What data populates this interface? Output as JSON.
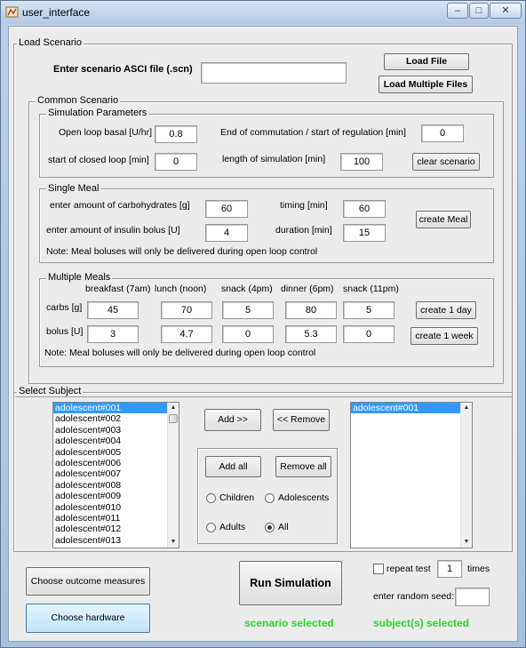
{
  "window": {
    "title": "user_interface",
    "controls": {
      "minimize": "–",
      "maximize": "□",
      "close": "✕"
    }
  },
  "load_scenario": {
    "legend": "Load Scenario",
    "file_label": "Enter scenario ASCI file (.scn)",
    "file_value": "",
    "load_file_button": "Load File",
    "load_multiple_button": "Load Multiple Files"
  },
  "common_scenario": {
    "legend": "Common Scenario",
    "simulation_parameters": {
      "legend": "Simulation Parameters",
      "open_loop_basal_label": "Open loop basal [U/hr]",
      "open_loop_basal_value": "0.8",
      "end_commutation_label": "End of commutation / start of regulation [min]",
      "end_commutation_value": "0",
      "start_closed_loop_label": "start of closed loop [min]",
      "start_closed_loop_value": "0",
      "length_label": "length of simulation [min]",
      "length_value": "100",
      "clear_button": "clear scenario"
    },
    "single_meal": {
      "legend": "Single Meal",
      "carbs_label": "enter amount of carbohydrates [g]",
      "carbs_value": "60",
      "timing_label": "timing [min]",
      "timing_value": "60",
      "insulin_label": "enter amount of insulin bolus [U]",
      "insulin_value": "4",
      "duration_label": "duration [min]",
      "duration_value": "15",
      "create_button": "create Meal",
      "note": "Note: Meal boluses will only be delivered during open loop control"
    },
    "multiple_meals": {
      "legend": "Multiple Meals",
      "columns": [
        "breakfast (7am)",
        "lunch (noon)",
        "snack (4pm)",
        "dinner (6pm)",
        "snack (11pm)"
      ],
      "carbs_label": "carbs [g]",
      "carbs": [
        "45",
        "70",
        "5",
        "80",
        "5"
      ],
      "bolus_label": "bolus [U]",
      "bolus": [
        "3",
        "4.7",
        "0",
        "5.3",
        "0"
      ],
      "create_day_button": "create 1 day",
      "create_week_button": "create 1 week",
      "note": "Note: Meal boluses will only be delivered during open loop control"
    }
  },
  "select_subject": {
    "legend": "Select Subject",
    "available": [
      "adolescent#001",
      "adolescent#002",
      "adolescent#003",
      "adolescent#004",
      "adolescent#005",
      "adolescent#006",
      "adolescent#007",
      "adolescent#008",
      "adolescent#009",
      "adolescent#010",
      "adolescent#011",
      "adolescent#012",
      "adolescent#013"
    ],
    "selected": [
      "adolescent#001"
    ],
    "add_button": "Add >>",
    "remove_button": "<< Remove",
    "add_all_button": "Add all",
    "remove_all_button": "Remove all",
    "radio_children": "Children",
    "radio_adolescents": "Adolescents",
    "radio_adults": "Adults",
    "radio_all": "All"
  },
  "bottom": {
    "outcome_button": "Choose outcome measures",
    "hardware_button": "Choose hardware",
    "run_button": "Run Simulation",
    "repeat_label": "repeat test",
    "repeat_value": "1",
    "times_label": "times",
    "seed_label": "enter random seed:",
    "seed_value": "",
    "scenario_status": "scenario selected",
    "subject_status": "subject(s) selected",
    "status_color": "#2fd32f"
  }
}
